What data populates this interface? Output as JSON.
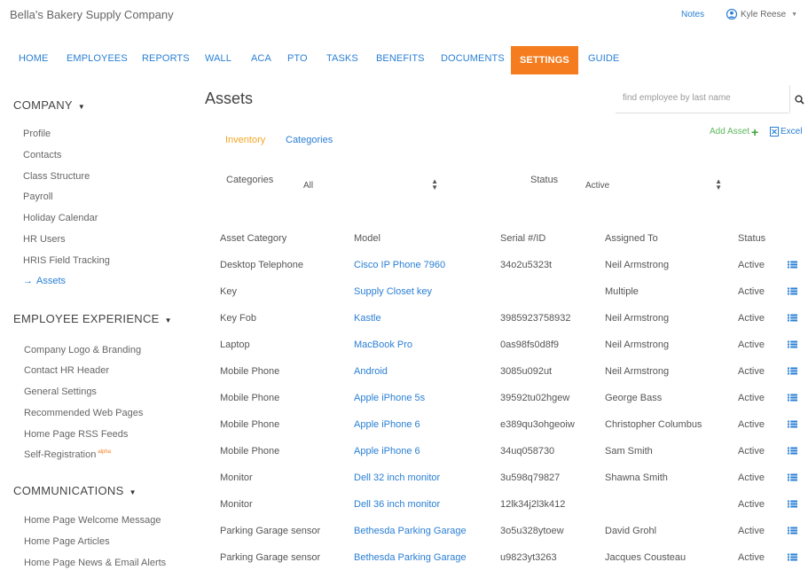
{
  "header": {
    "brand": "Bella's Bakery Supply Company",
    "notes": "Notes",
    "user": "Kyle Reese"
  },
  "nav": [
    "HOME",
    "EMPLOYEES",
    "REPORTS",
    "WALL",
    "ACA",
    "PTO",
    "TASKS",
    "BENEFITS",
    "DOCUMENTS",
    "SETTINGS",
    "GUIDE"
  ],
  "nav_active": "SETTINGS",
  "sidebar": {
    "sections": [
      {
        "title": "COMPANY",
        "items": [
          "Profile",
          "Contacts",
          "Class Structure",
          "Payroll",
          "Holiday Calendar",
          "HR Users",
          "HRIS Field Tracking",
          "Assets"
        ]
      },
      {
        "title": "EMPLOYEE EXPERIENCE",
        "items": [
          "Company Logo & Branding",
          "Contact HR Header",
          "General Settings",
          "Recommended Web Pages",
          "Home Page RSS Feeds",
          "Self-Registration"
        ]
      },
      {
        "title": "COMMUNICATIONS",
        "items": [
          "Home Page Welcome Message",
          "Home Page Articles",
          "Home Page News & Email Alerts"
        ]
      }
    ],
    "current_item": "Assets",
    "current_arrow": "→",
    "alpha_badge": "alpha"
  },
  "main": {
    "title": "Assets",
    "search": {
      "placeholder": "find employee by last name",
      "value": ""
    },
    "tabs": {
      "inventory": "Inventory",
      "categories": "Categories"
    },
    "add_asset": "Add Asset",
    "excel": "Excel",
    "filters": {
      "categories_label": "Categories",
      "categories_value": "All",
      "status_label": "Status",
      "status_value": "Active"
    },
    "table": {
      "columns": [
        "Asset Category",
        "Model",
        "Serial #/ID",
        "Assigned To",
        "Status"
      ],
      "rows": [
        [
          "Desktop Telephone",
          "Cisco IP Phone 7960",
          "34o2u5323t",
          "Neil Armstrong",
          "Active"
        ],
        [
          "Key",
          "Supply Closet key",
          "",
          "Multiple",
          "Active"
        ],
        [
          "Key Fob",
          "Kastle",
          "3985923758932",
          "Neil Armstrong",
          "Active"
        ],
        [
          "Laptop",
          "MacBook Pro",
          "0as98fs0d8f9",
          "Neil Armstrong",
          "Active"
        ],
        [
          "Mobile Phone",
          "Android",
          "3085u092ut",
          "Neil Armstrong",
          "Active"
        ],
        [
          "Mobile Phone",
          "Apple iPhone 5s",
          "39592tu02hgew",
          "George Bass",
          "Active"
        ],
        [
          "Mobile Phone",
          "Apple iPhone 6",
          "e389qu3ohgeoiw",
          "Christopher Columbus",
          "Active"
        ],
        [
          "Mobile Phone",
          "Apple iPhone 6",
          "34uq058730",
          "Sam Smith",
          "Active"
        ],
        [
          "Monitor",
          "Dell 32 inch monitor",
          "3u598q79827",
          "Shawna Smith",
          "Active"
        ],
        [
          "Monitor",
          "Dell 36 inch monitor",
          "12lk34j2l3k412",
          "",
          "Active"
        ],
        [
          "Parking Garage sensor",
          "Bethesda Parking Garage",
          "3o5u328ytoew",
          "David Grohl",
          "Active"
        ],
        [
          "Parking Garage sensor",
          "Bethesda Parking Garage",
          "u9823yt3263",
          "Jacques Cousteau",
          "Active"
        ]
      ]
    }
  },
  "colors": {
    "accent": "#f57c1f",
    "link": "#2a7fd4",
    "add": "#5cb85c",
    "subtab_active": "#f5a623"
  },
  "icons": [
    "user-icon",
    "search-icon",
    "plus-icon",
    "excel-icon",
    "list-icon",
    "arrow-right-icon"
  ]
}
